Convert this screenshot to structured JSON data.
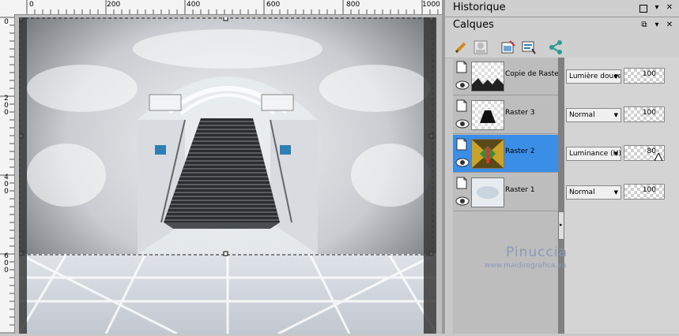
{
  "ruler": {
    "top_labels": [
      "0",
      "200",
      "400",
      "600",
      "800",
      "1000"
    ],
    "left_labels": [
      "0",
      "200",
      "400",
      "600"
    ]
  },
  "panels": {
    "history_title": "Historique",
    "layers_title": "Calques"
  },
  "layers": [
    {
      "name": "Copie de Raster",
      "blend": "Lumière douce",
      "opacity": "100",
      "selected": false
    },
    {
      "name": "Raster 3",
      "blend": "Normal",
      "opacity": "100",
      "selected": false
    },
    {
      "name": "Raster 2",
      "blend": "Luminance (H)",
      "opacity": "80",
      "selected": true
    },
    {
      "name": "Raster 1",
      "blend": "Normal",
      "opacity": "100",
      "selected": false
    }
  ],
  "watermark": {
    "name": "Pinuccia",
    "url": "www.maidiregrafica.eu"
  },
  "colors": {
    "selection": "#3a8ee6",
    "watermark": "#8a9ab8"
  }
}
